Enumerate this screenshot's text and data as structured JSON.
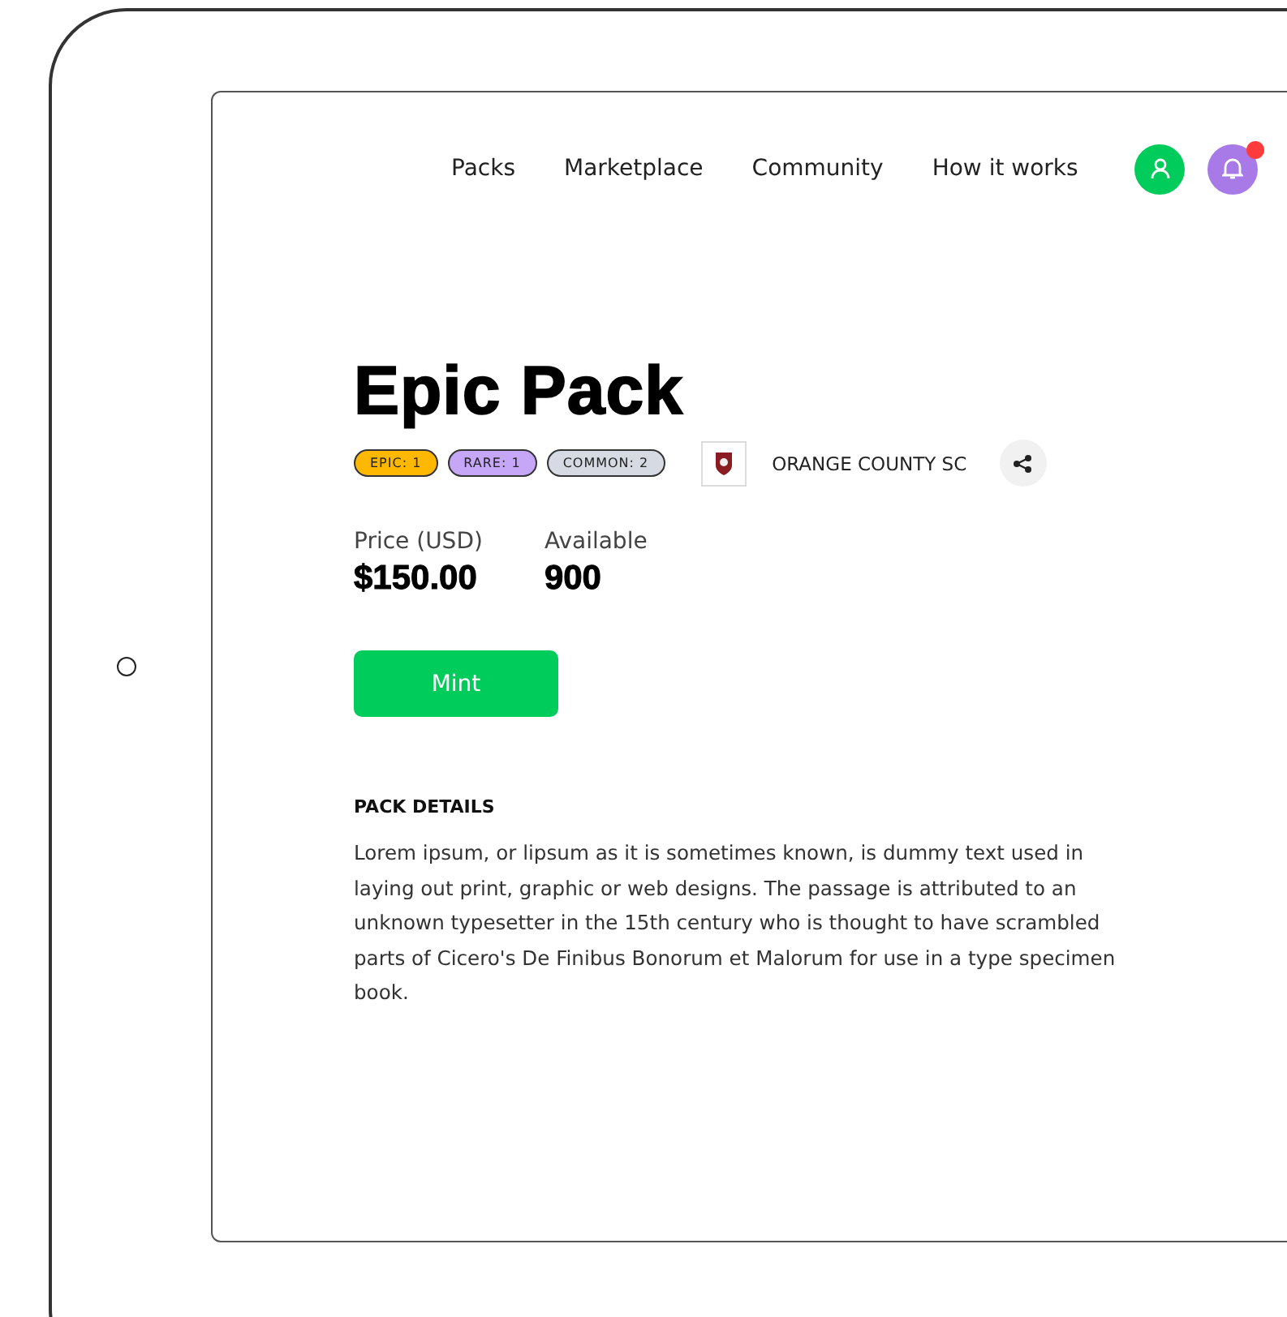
{
  "nav": {
    "links": [
      "Packs",
      "Marketplace",
      "Community",
      "How it works"
    ],
    "notification_badge": true
  },
  "pack": {
    "title": "Epic Pack",
    "tags": [
      {
        "label": "EPIC: 1",
        "color": "#ffb800"
      },
      {
        "label": "RARE: 1",
        "color": "#c6a6f7"
      },
      {
        "label": "COMMON: 2",
        "color": "#d6dae2"
      }
    ],
    "club": "ORANGE COUNTY SC",
    "stats": [
      {
        "label": "Price (USD)",
        "value": "$150.00"
      },
      {
        "label": "Available",
        "value": "900"
      }
    ],
    "button": "Mint",
    "details_heading": "PACK DETAILS",
    "details": "Lorem ipsum, or lipsum as it is sometimes known, is dummy text used in laying out print, graphic or web designs. The passage is attributed to an unknown typesetter in the 15th century who is thought to have scrambled parts of Cicero's De Finibus Bonorum et Malorum for use in a type specimen book."
  }
}
